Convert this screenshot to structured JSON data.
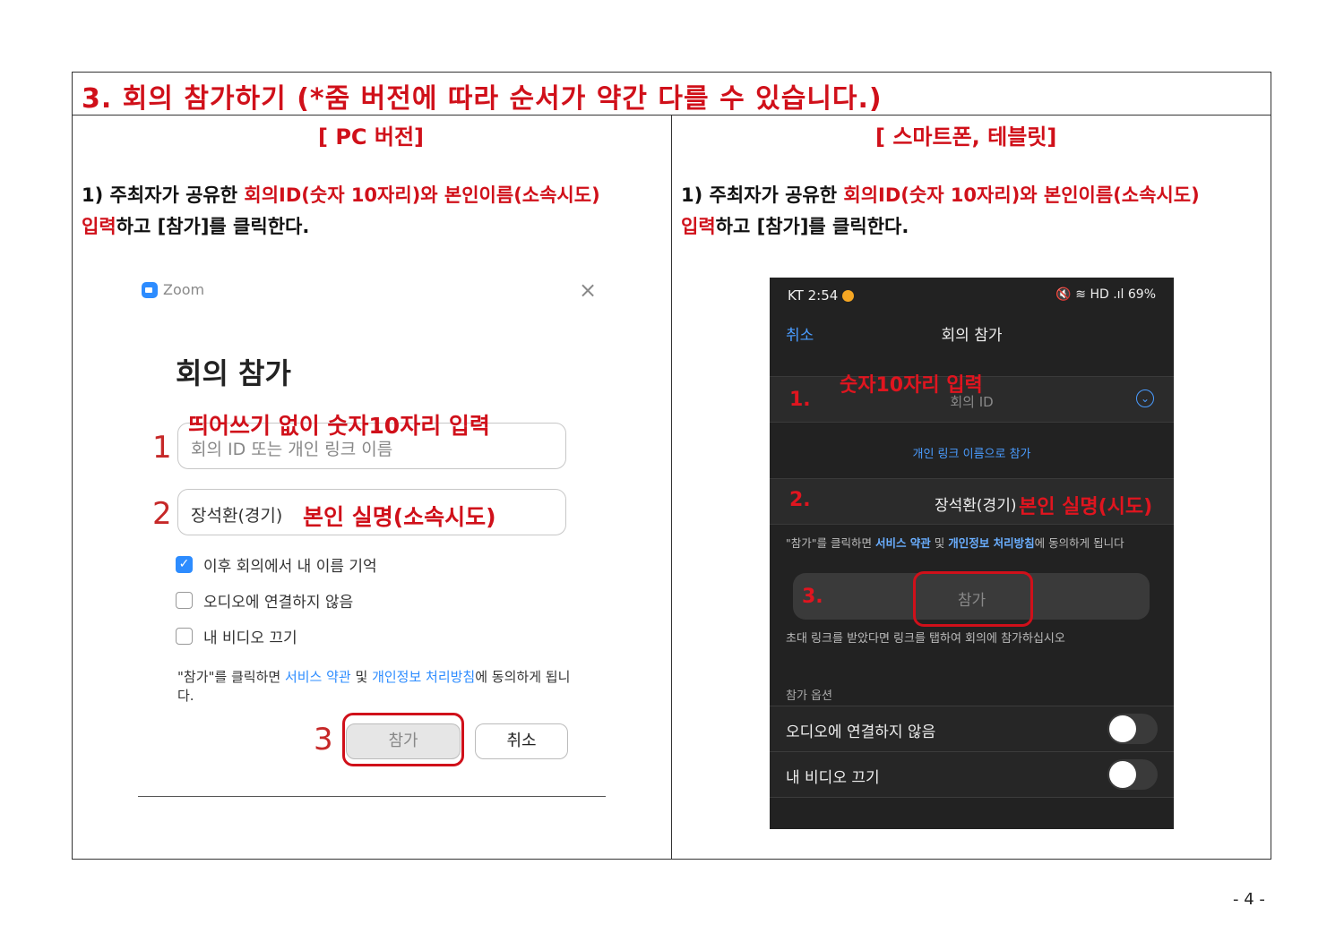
{
  "title": "3. 회의 참가하기 (*줌 버전에 따라 순서가 약간 다를 수 있습니다.)",
  "pc": {
    "heading": "[ PC 버전]",
    "instr_line1_prefix": "1) 주최자가 공유한 ",
    "instr_line1_red": "회의ID(숫자 10자리)와 본인이름(소속시도)",
    "instr_line2_red": "입력",
    "instr_line2_rest": "하고 [참가]를 클릭한다.",
    "app_name": "Zoom",
    "close": "×",
    "dialog_title": "회의 참가",
    "step1": "1",
    "step2": "2",
    "step3": "3",
    "note1": "띄어쓰기 없이 숫자10자리 입력",
    "id_placeholder": "회의 ID 또는 개인 링크 이름",
    "name_value": "장석환(경기)",
    "note2": "본인 실명(소속시도)",
    "check1": "이후 회의에서 내 이름 기억",
    "check2": "오디오에 연결하지 않음",
    "check3": "내 비디오 끄기",
    "terms_pre": "\"참가\"를 클릭하면 ",
    "terms_link1": "서비스 약관",
    "terms_mid": " 및 ",
    "terms_link2": "개인정보 처리방침",
    "terms_post": "에 동의하게 됩니다.",
    "join_button": "참가",
    "cancel_button": "취소"
  },
  "mobile": {
    "heading": "[ 스마트폰, 테블릿]",
    "instr_line1_prefix": "1) 주최자가 공유한 ",
    "instr_line1_red": "회의ID(숫자 10자리)와 본인이름(소속시도)",
    "instr_line2_red": "입력",
    "instr_line2_rest": "하고 [참가]를 클릭한다.",
    "status_time": "KT 2:54",
    "status_right": "🔇 ≋ HD .ıl 69%",
    "cancel": "취소",
    "title": "회의 참가",
    "meeting_id": "회의 ID",
    "step1": "1.",
    "note1": "숫자10자리 입력",
    "personal_link": "개인 링크 이름으로 참가",
    "step2": "2.",
    "name_value": "장석환(경기)",
    "note2": "본인 실명(시도)",
    "terms_pre": "\"참가\"를 클릭하면 ",
    "terms_link1": "서비스 약관",
    "terms_mid": " 및 ",
    "terms_link2": "개인정보 처리방침",
    "terms_post": "에 동의하게 됩니다",
    "step3": "3.",
    "join_button": "참가",
    "invite_note": "초대 링크를 받았다면 링크를 탭하여 회의에 참가하십시오",
    "options_label": "참가 옵션",
    "option1": "오디오에 연결하지 않음",
    "option2": "내 비디오 끄기"
  },
  "page_number": "- 4 -",
  "colors": {
    "accent_red": "#d0101a",
    "zoom_blue": "#2d8cff",
    "phone_bg": "#222222"
  }
}
